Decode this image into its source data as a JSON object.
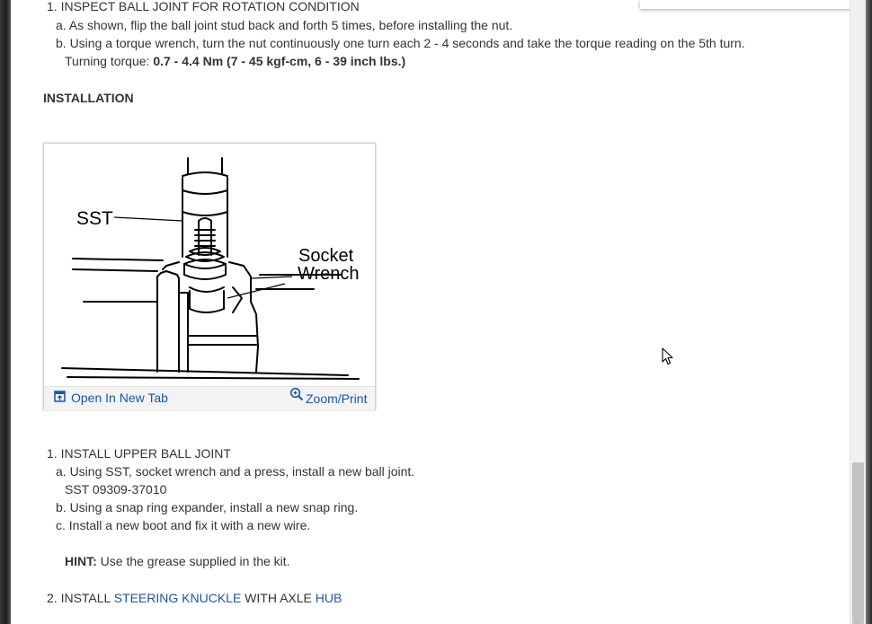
{
  "step1": {
    "heading_partial": "1. INSPECT BALL JOINT FOR ROTATION CONDITION",
    "sub_a": "a. As shown, flip the ball joint stud back and forth 5 times, before installing the nut.",
    "sub_b": "b. Using a torque wrench, turn the nut continuously one turn each 2 - 4 seconds and take the torque reading on the 5th turn.",
    "torque_label": "Turning torque: ",
    "torque_value": "0.7 - 4.4 Nm (7 - 45 kgf-cm, 6 - 39 inch lbs.)"
  },
  "installation_heading": "INSTALLATION",
  "figure": {
    "label_sst": "SST",
    "label_socket": "Socket",
    "label_wrench": "Wrench",
    "open_tab": "Open In New Tab",
    "zoom_print": "Zoom/Print"
  },
  "install": {
    "item1": "1. INSTALL UPPER BALL JOINT",
    "sub_a": "a. Using SST, socket wrench and a press, install a new ball joint.",
    "sst": "SST 09309-37010",
    "sub_b": "b. Using a snap ring expander, install a new snap ring.",
    "sub_c": "c. Install a new boot and fix it with a new wire.",
    "hint_label": "HINT:",
    "hint_text": " Use the grease supplied in the kit.",
    "item2_prefix": "2. INSTALL ",
    "item2_link1": "STEERING KNUCKLE",
    "item2_mid": " WITH AXLE ",
    "item2_link2": "HUB"
  },
  "icons": [
    "open-in-new-tab-icon",
    "zoom-icon",
    "mouse-cursor-icon"
  ]
}
